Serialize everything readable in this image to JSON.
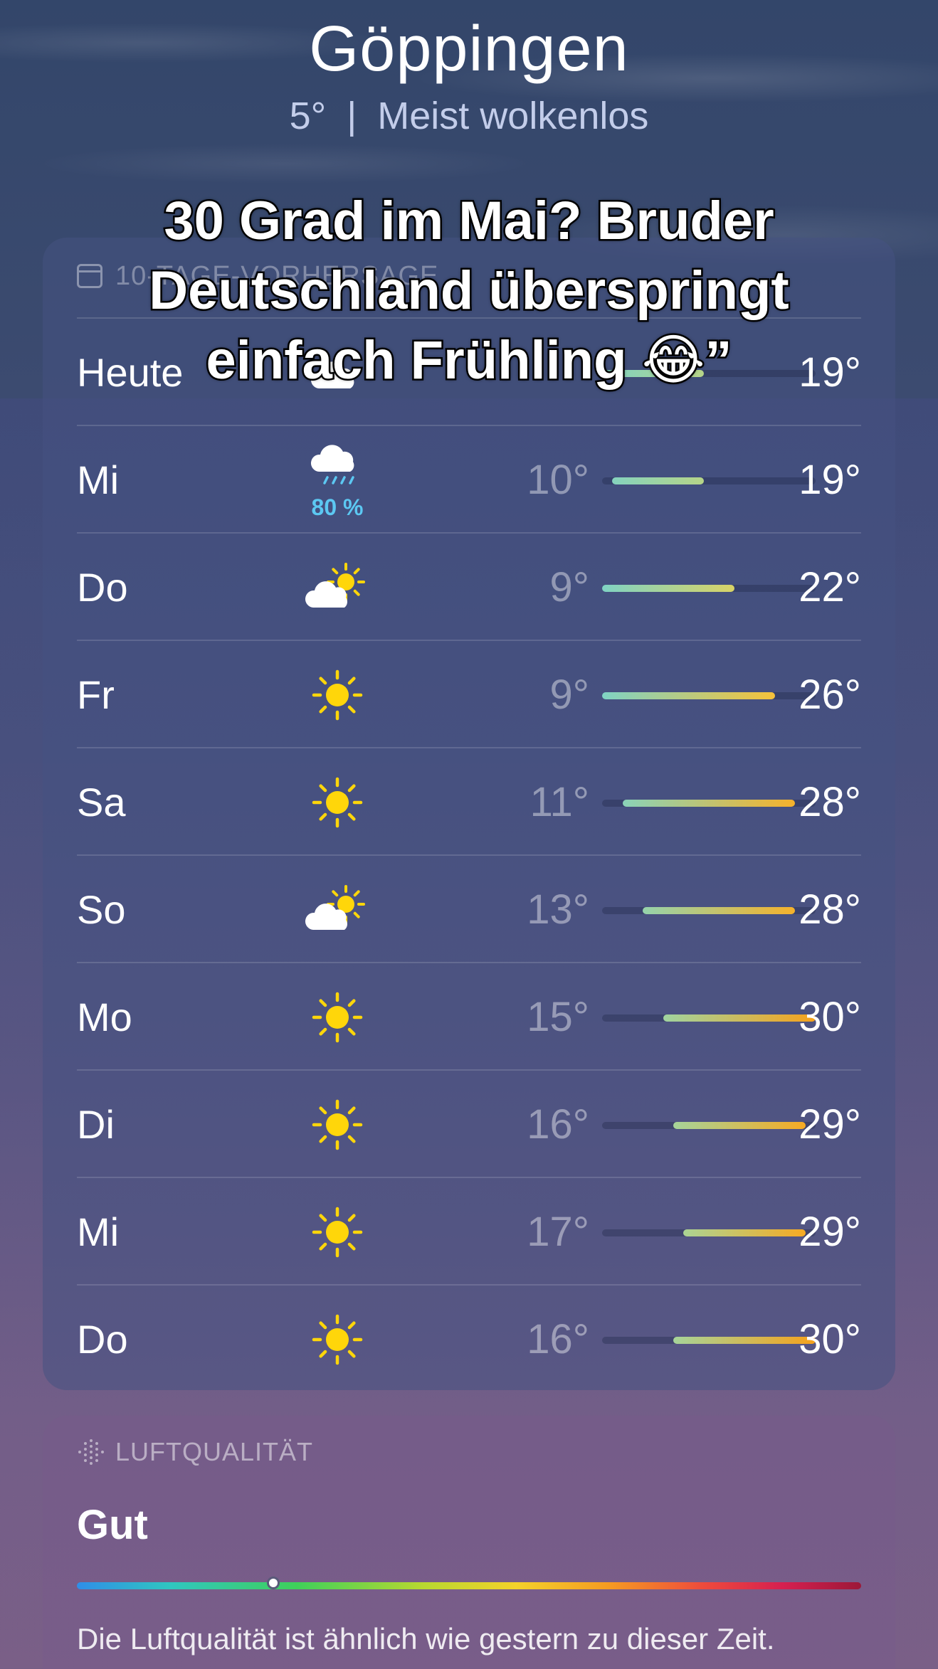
{
  "header": {
    "city": "Göppingen",
    "current_temp": "5°",
    "separator": "|",
    "condition": "Meist wolkenlos"
  },
  "overlay_caption": {
    "line1": "30 Grad im Mai? Bruder",
    "line2": "Deutschland überspringt",
    "line3": "einfach Frühling 😂”"
  },
  "forecast": {
    "header_label": "10-TAGE-VORHERSAGE",
    "scale": {
      "min": 9,
      "max": 30
    },
    "days": [
      {
        "day": "Heute",
        "icon": "cloud-icon",
        "precip": "",
        "low": "",
        "high": "19°",
        "low_val": 5,
        "high_val": 19
      },
      {
        "day": "Mi",
        "icon": "cloud-rain-icon",
        "precip": "80 %",
        "low": "10°",
        "high": "19°",
        "low_val": 10,
        "high_val": 19
      },
      {
        "day": "Do",
        "icon": "partly-sunny-icon",
        "precip": "",
        "low": "9°",
        "high": "22°",
        "low_val": 9,
        "high_val": 22
      },
      {
        "day": "Fr",
        "icon": "sun-icon",
        "precip": "",
        "low": "9°",
        "high": "26°",
        "low_val": 9,
        "high_val": 26
      },
      {
        "day": "Sa",
        "icon": "sun-icon",
        "precip": "",
        "low": "11°",
        "high": "28°",
        "low_val": 11,
        "high_val": 28
      },
      {
        "day": "So",
        "icon": "partly-sunny-icon",
        "precip": "",
        "low": "13°",
        "high": "28°",
        "low_val": 13,
        "high_val": 28
      },
      {
        "day": "Mo",
        "icon": "sun-icon",
        "precip": "",
        "low": "15°",
        "high": "30°",
        "low_val": 15,
        "high_val": 30
      },
      {
        "day": "Di",
        "icon": "sun-icon",
        "precip": "",
        "low": "16°",
        "high": "29°",
        "low_val": 16,
        "high_val": 29
      },
      {
        "day": "Mi",
        "icon": "sun-icon",
        "precip": "",
        "low": "17°",
        "high": "29°",
        "low_val": 17,
        "high_val": 29
      },
      {
        "day": "Do",
        "icon": "sun-icon",
        "precip": "",
        "low": "16°",
        "high": "30°",
        "low_val": 16,
        "high_val": 30
      }
    ]
  },
  "air_quality": {
    "header_label": "LUFTQUALITÄT",
    "value": "Gut",
    "level_fraction": 0.25,
    "description": "Die Luftqualität ist ähnlich wie gestern zu dieser Zeit."
  },
  "colors": {
    "precip": "#5cc8f2",
    "cool": "#7fd3c4",
    "warm": "#f5d24a",
    "hot": "#f7a21b",
    "sun": "#ffd60a"
  }
}
